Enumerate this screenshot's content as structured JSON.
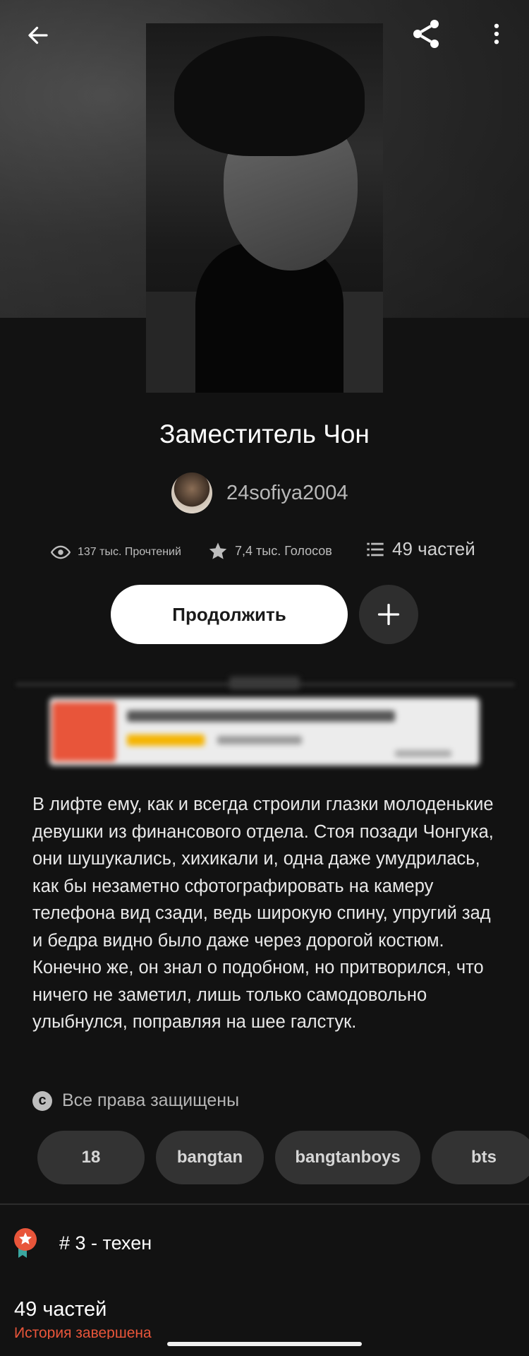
{
  "story": {
    "title": "Заместитель Чон",
    "author": "24sofiya2004",
    "stats": {
      "reads": "137 тыс. Прочтений",
      "votes": "7,4 тыс. Голосов",
      "parts": "49 частей"
    },
    "actions": {
      "continue_label": "Продолжить",
      "add_label": "+"
    },
    "description": "В лифте ему, как и всегда строили глазки молоденькие девушки из финансового отдела. Стоя позади Чонгука, они шушукались, хихикали и, одна даже умудрилась, как бы незаметно сфотографировать на камеру телефона вид сзади, ведь широкую спину, упругий зад и бедра видно было даже через дорогой костюм. Конечно же, он знал о подобном, но притворился, что ничего не заметил, лишь только самодовольно улыбнулся, поправляя на шее галстук.",
    "copyright": "Все права защищены",
    "copyright_symbol": "c",
    "tags": [
      "18",
      "bangtan",
      "bangtanboys",
      "bts"
    ],
    "rank": "# 3 - техен",
    "parts_count": "49 частей",
    "status": "История завершена"
  },
  "icons": {
    "back": "arrow-left-icon",
    "share": "share-icon",
    "more": "more-vertical-icon",
    "reads": "eye-icon",
    "votes": "star-icon",
    "parts": "list-icon",
    "add": "plus-icon",
    "copyright": "copyright-icon",
    "rank": "ranking-badge-icon"
  },
  "colors": {
    "background": "#121212",
    "accent": "#e8553a",
    "button_primary": "#ffffff",
    "chip": "#333333"
  }
}
